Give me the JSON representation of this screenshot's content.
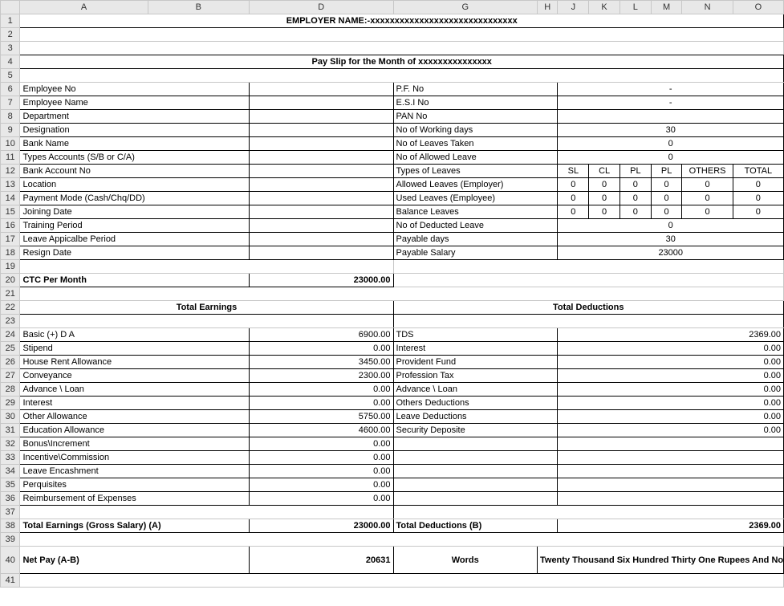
{
  "columns": [
    "A",
    "B",
    "D",
    "G",
    "H",
    "J",
    "K",
    "L",
    "M",
    "N",
    "O"
  ],
  "header": {
    "employer_name": "EMPLOYER NAME:-xxxxxxxxxxxxxxxxxxxxxxxxxxxxxx",
    "payslip_title": "Pay Slip for the Month of xxxxxxxxxxxxxxx"
  },
  "emp_left": {
    "r6": "Employee No",
    "r7": "Employee Name",
    "r8": "Department",
    "r9": "Designation",
    "r10": "Bank Name",
    "r11": "Types Accounts (S/B or C/A)",
    "r12": "Bank Account No",
    "r13": "Location",
    "r14": "Payment Mode (Cash/Chq/DD)",
    "r15": "Joining Date",
    "r16": "Training Period",
    "r17": "Leave Appicalbe Period",
    "r18": "Resign Date"
  },
  "emp_right_label": {
    "r6": "P.F. No",
    "r7": "E.S.I No",
    "r8": "PAN No",
    "r9": "No of Working days",
    "r10": "No of Leaves Taken",
    "r11": "No of Allowed Leave",
    "r12": "Types of Leaves",
    "r13": "Allowed Leaves (Employer)",
    "r14": "Used Leaves (Employee)",
    "r15": "Balance Leaves",
    "r16": "No of Deducted Leave",
    "r17": "Payable days",
    "r18": "Payable Salary"
  },
  "emp_right_val": {
    "r6": "-",
    "r7": "-",
    "r9": "30",
    "r10": "0",
    "r11": "0",
    "r16": "0",
    "r17": "30",
    "r18": "23000"
  },
  "leave_headers": {
    "h1": "SL",
    "h2": "CL",
    "h3": "PL",
    "h4": "PL",
    "h5": "OTHERS",
    "h6": "TOTAL"
  },
  "leave_zero": "0",
  "ctc": {
    "label": "CTC Per Month",
    "value": "23000.00"
  },
  "section": {
    "earnings": "Total Earnings",
    "deductions": "Total Deductions"
  },
  "earn": {
    "r24l": "Basic (+) D A",
    "r24v": "6900.00",
    "r25l": "Stipend",
    "r25v": "0.00",
    "r26l": "House Rent Allowance",
    "r26v": "3450.00",
    "r27l": "Conveyance",
    "r27v": "2300.00",
    "r28l": "Advance \\ Loan",
    "r28v": "0.00",
    "r29l": "Interest",
    "r29v": "0.00",
    "r30l": "Other Allowance",
    "r30v": "5750.00",
    "r31l": "Education Allowance",
    "r31v": "4600.00",
    "r32l": "Bonus\\Increment",
    "r32v": "0.00",
    "r33l": "Incentive\\Commission",
    "r33v": "0.00",
    "r34l": "Leave Encashment",
    "r34v": "0.00",
    "r35l": "Perquisites",
    "r35v": "0.00",
    "r36l": "Reimbursement of Expenses",
    "r36v": "0.00"
  },
  "ded": {
    "r24l": "TDS",
    "r24v": "2369.00",
    "r25l": "Interest",
    "r25v": "0.00",
    "r26l": "Provident Fund",
    "r26v": "0.00",
    "r27l": "Profession Tax",
    "r27v": "0.00",
    "r28l": "Advance \\ Loan",
    "r28v": "0.00",
    "r29l": "Others Deductions",
    "r29v": "0.00",
    "r30l": "Leave Deductions",
    "r30v": "0.00",
    "r31l": "Security Deposite",
    "r31v": "0.00"
  },
  "totals": {
    "earn_label": "Total Earnings (Gross Salary) (A)",
    "earn_val": "23000.00",
    "ded_label": "Total Deductions (B)",
    "ded_val": "2369.00"
  },
  "netpay": {
    "label": "Net Pay (A-B)",
    "value": "20631",
    "words_label": "Words",
    "words": "Twenty Thousand Six Hundred Thirty One Rupees And No Paisa"
  }
}
